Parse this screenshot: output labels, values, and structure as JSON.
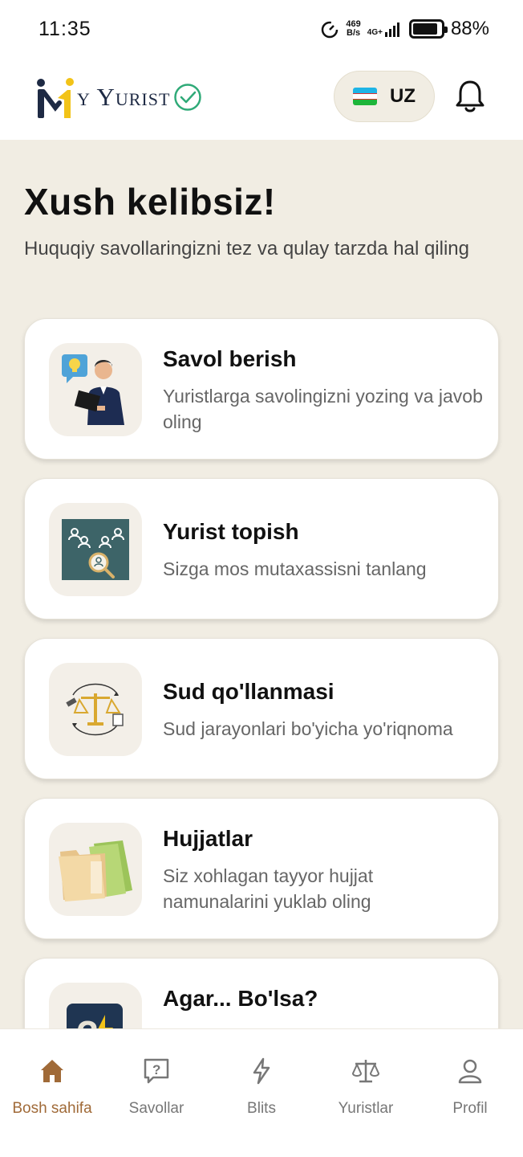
{
  "status_bar": {
    "time": "11:35",
    "net_speed_value": "469",
    "net_speed_unit": "B/s",
    "network": "4G+",
    "battery": "88%",
    "battery_level": 0.88
  },
  "header": {
    "logo_text": "y Yurist",
    "language": "UZ",
    "brand_color": "#1e2a44",
    "accent_color": "#f2c318",
    "check_color": "#2faa78"
  },
  "welcome": {
    "title": "Xush kelibsiz!",
    "subtitle": "Huquqiy savollaringizni tez va qulay tarzda hal qiling"
  },
  "cards": [
    {
      "title": "Savol berish",
      "desc": "Yuristlarga savolingizni yozing va javob oling",
      "icon": "lawyer-question-icon"
    },
    {
      "title": "Yurist topish",
      "desc": "Sizga mos mutaxassisni tanlang",
      "icon": "find-lawyer-icon"
    },
    {
      "title": "Sud qo'llanmasi",
      "desc": "Sud jarayonlari bo'yicha yo'riqnoma",
      "icon": "court-scales-icon"
    },
    {
      "title": "Hujjatlar",
      "desc": "Siz xohlagan tayyor hujjat namunalarini yuklab oling",
      "icon": "folders-icon"
    },
    {
      "title": "Agar... Bo'lsa?",
      "desc": "",
      "icon": "what-if-icon"
    }
  ],
  "bottom_nav": {
    "items": [
      {
        "label": "Bosh sahifa",
        "icon": "home-icon",
        "active": true
      },
      {
        "label": "Savollar",
        "icon": "question-icon",
        "active": false
      },
      {
        "label": "Blits",
        "icon": "lightning-icon",
        "active": false
      },
      {
        "label": "Yuristlar",
        "icon": "scales-icon",
        "active": false
      },
      {
        "label": "Profil",
        "icon": "user-icon",
        "active": false
      }
    ],
    "active_color": "#a06a38",
    "inactive_color": "#777777"
  }
}
